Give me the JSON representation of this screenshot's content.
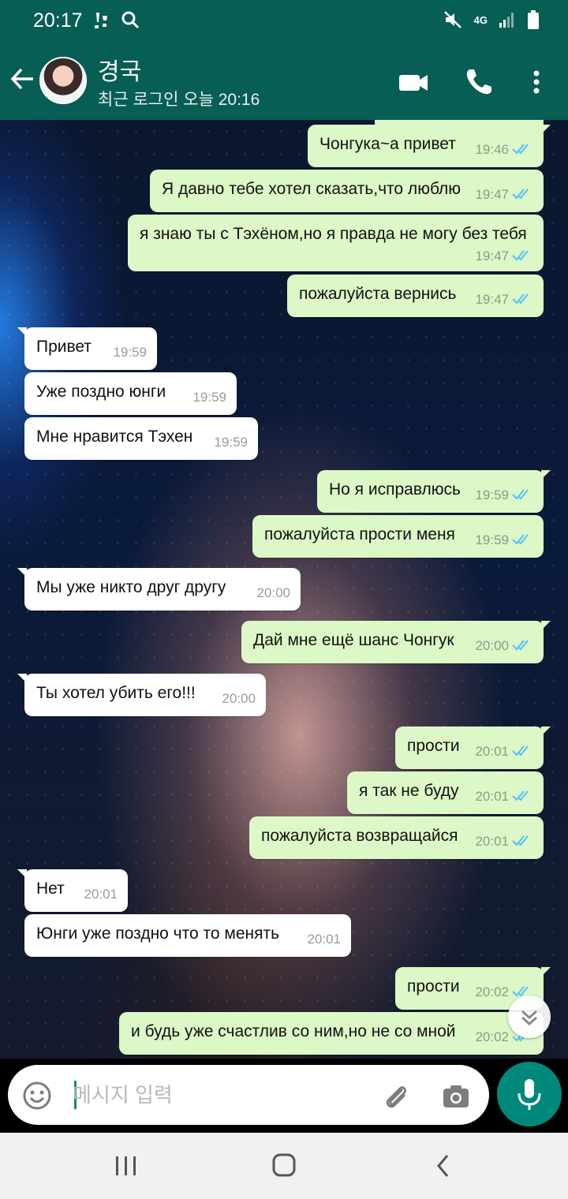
{
  "status_bar": {
    "time": "20:17",
    "network": "4G",
    "icons": [
      "notification-icon",
      "search-icon",
      "mute-icon",
      "network-4g-icon",
      "signal-icon",
      "battery-icon"
    ]
  },
  "header": {
    "contact_name": "경국",
    "last_seen": "최근 로그인 오늘 20:16",
    "icons": [
      "back-arrow-icon",
      "video-call-icon",
      "phone-icon",
      "more-icon"
    ],
    "color": "#075e54"
  },
  "messages": [
    {
      "dir": "out",
      "text": "Чонгука~а привет",
      "time": "19:46"
    },
    {
      "dir": "out",
      "text": "Я давно тебе хотел сказать,что люблю",
      "time": "19:47"
    },
    {
      "dir": "out",
      "text": "я знаю ты с Тэхёном,но я правда не могу без тебя",
      "time": "19:47"
    },
    {
      "dir": "out",
      "text": "пожалуйста вернись",
      "time": "19:47"
    },
    {
      "dir": "in",
      "text": "Привет",
      "time": "19:59"
    },
    {
      "dir": "in",
      "text": "Уже поздно юнги",
      "time": "19:59"
    },
    {
      "dir": "in",
      "text": "Мне нравится Тэхен",
      "time": "19:59"
    },
    {
      "dir": "out",
      "text": "Но я исправлюсь",
      "time": "19:59"
    },
    {
      "dir": "out",
      "text": "пожалуйста прости меня",
      "time": "19:59"
    },
    {
      "dir": "in",
      "text": "Мы уже никто друг другу",
      "time": "20:00"
    },
    {
      "dir": "out",
      "text": "Дай мне ещё шанс Чонгук",
      "time": "20:00"
    },
    {
      "dir": "in",
      "text": "Ты хотел убить его!!!",
      "time": "20:00"
    },
    {
      "dir": "out",
      "text": "прости",
      "time": "20:01"
    },
    {
      "dir": "out",
      "text": "я так не буду",
      "time": "20:01"
    },
    {
      "dir": "out",
      "text": "пожалуйста возвращайся",
      "time": "20:01"
    },
    {
      "dir": "in",
      "text": "Нет",
      "time": "20:01"
    },
    {
      "dir": "in",
      "text": "Юнги уже поздно что то менять",
      "time": "20:01"
    },
    {
      "dir": "out",
      "text": "прости",
      "time": "20:02"
    },
    {
      "dir": "out",
      "text": "и будь уже счастлив со ним,но не со мной",
      "time": "20:02"
    }
  ],
  "colors": {
    "outgoing_bubble": "#dcf8c6",
    "incoming_bubble": "#ffffff",
    "read_ticks": "#4fc3f7",
    "accent": "#00897b"
  },
  "input": {
    "placeholder": "메시지 입력",
    "value": "",
    "icons": [
      "emoji-icon",
      "attach-icon",
      "camera-icon",
      "mic-icon"
    ]
  },
  "nav_bar": {
    "icons": [
      "recent-apps-icon",
      "home-icon",
      "back-icon"
    ]
  }
}
